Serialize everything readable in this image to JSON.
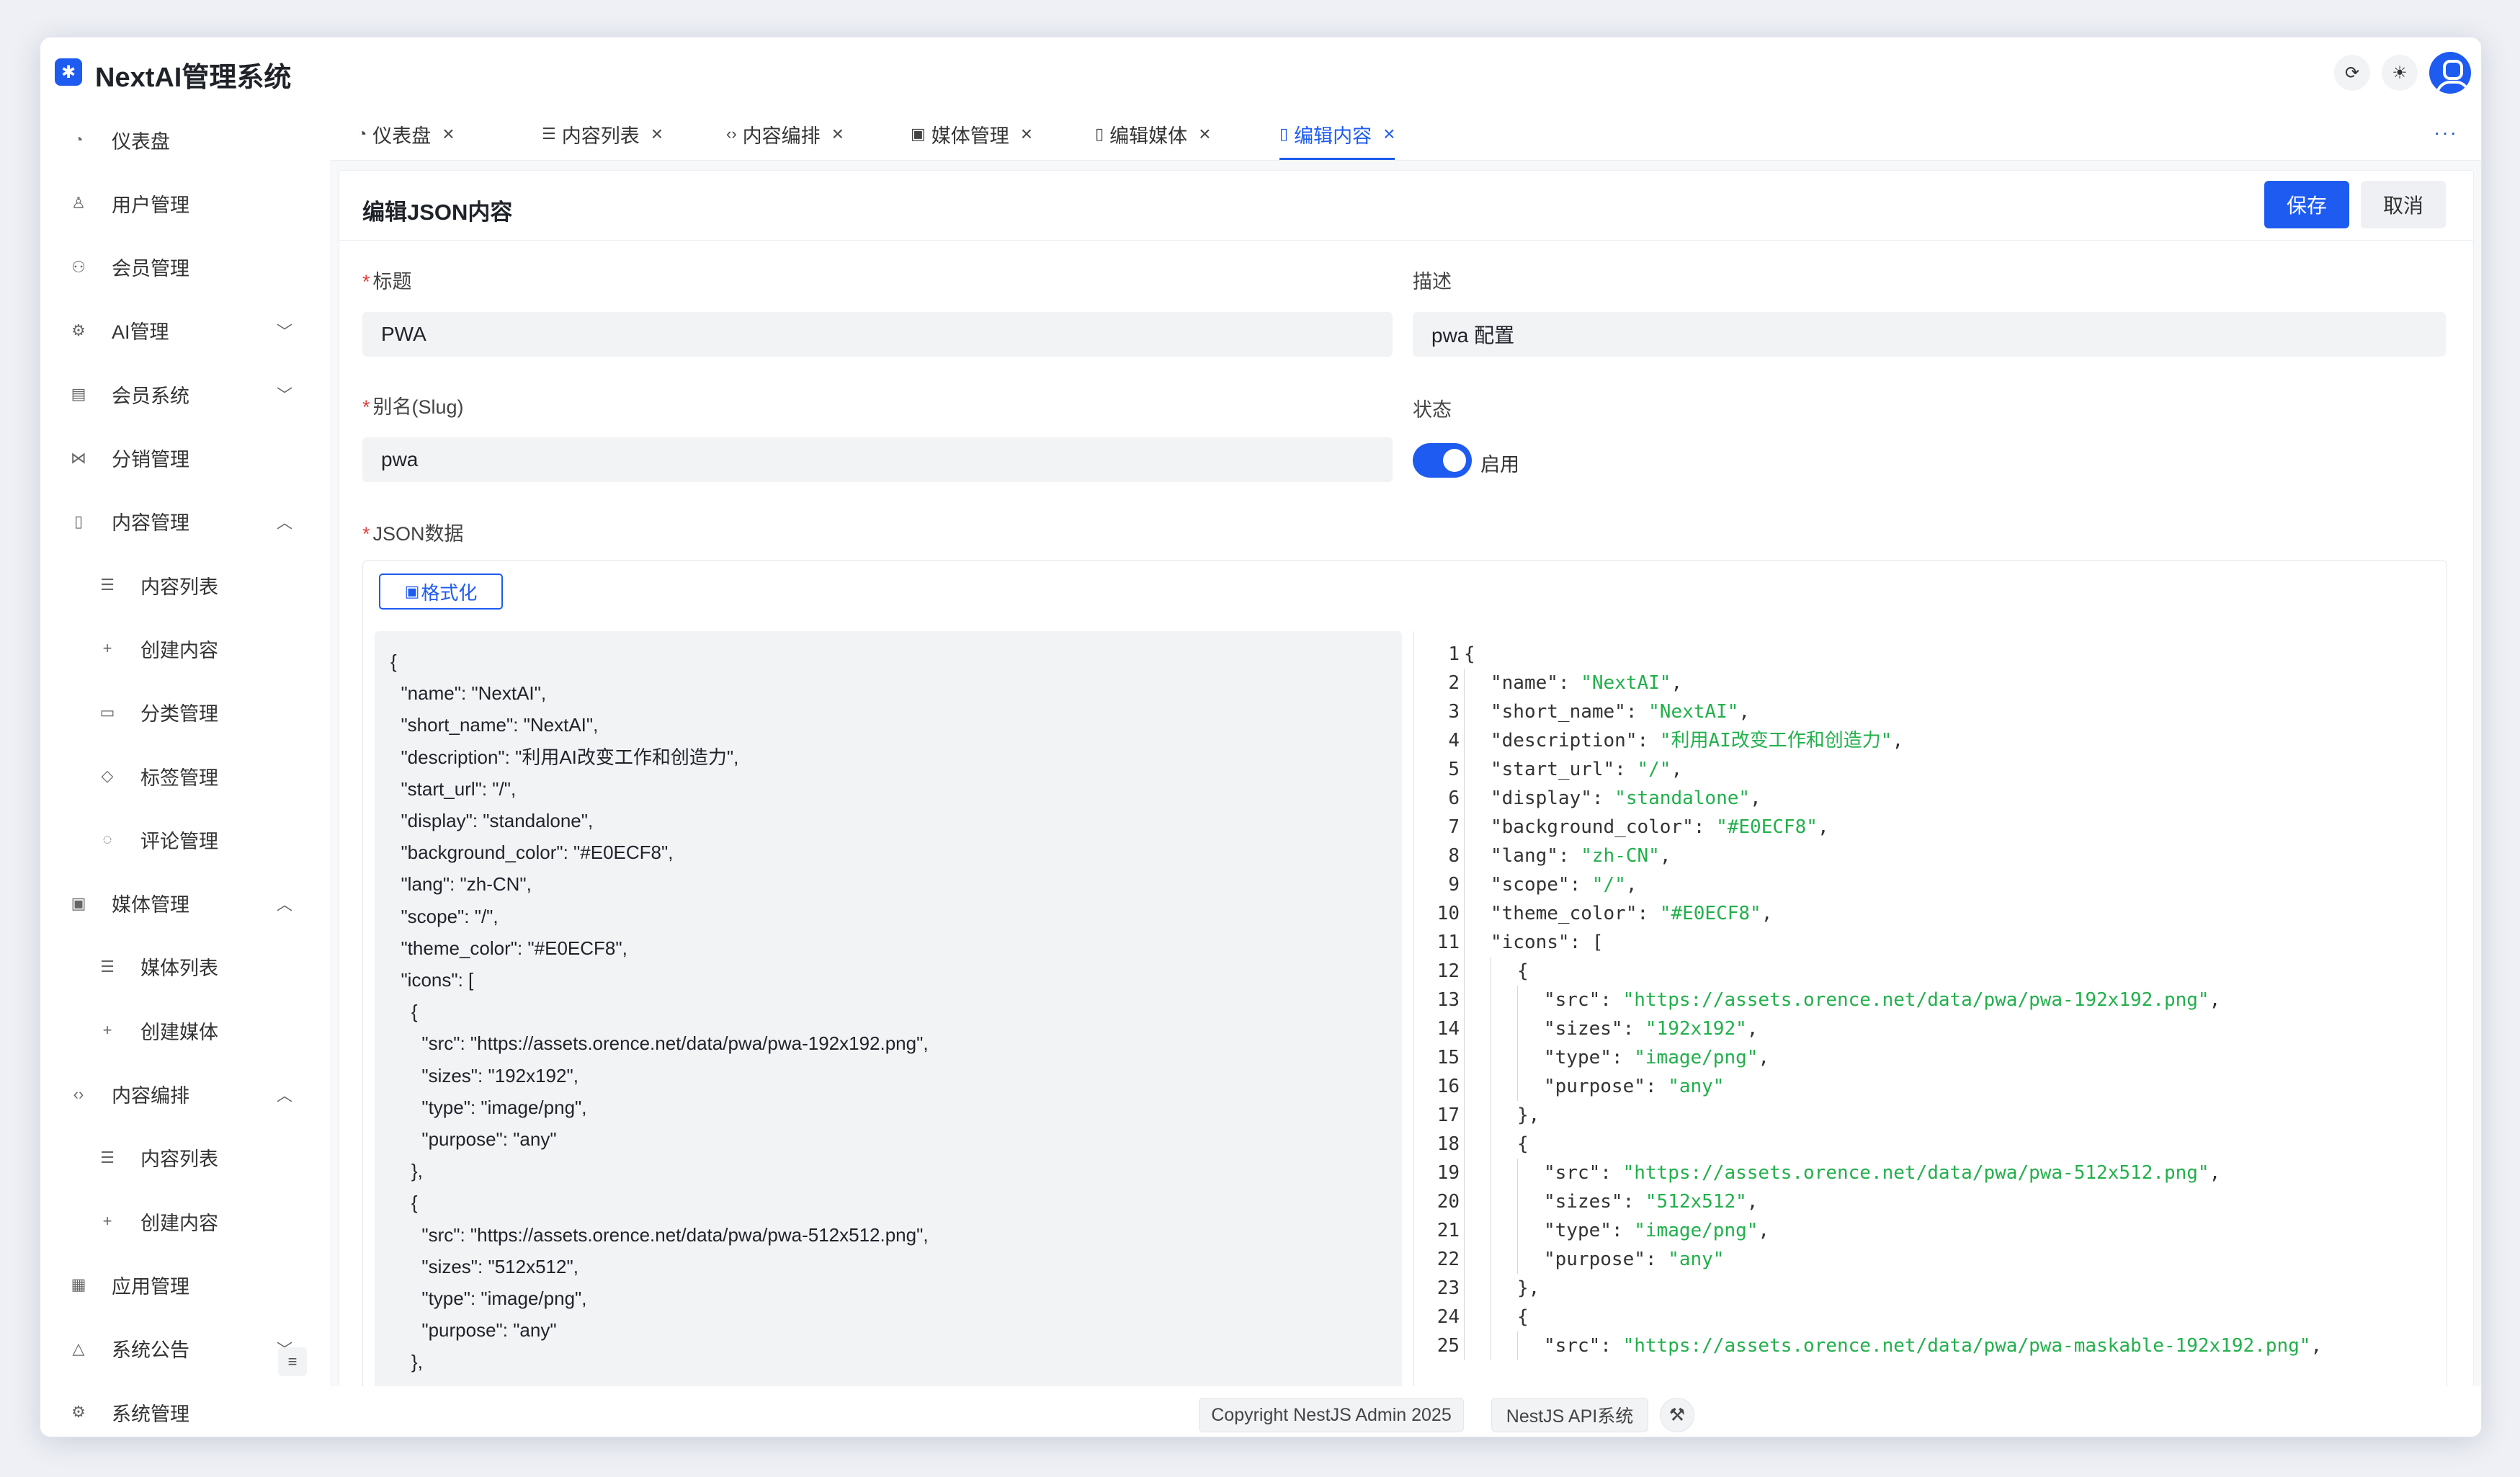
{
  "app": {
    "title": "NextAI管理系统"
  },
  "header": {
    "refresh_icon": "refresh-icon",
    "theme_icon": "sun-icon",
    "avatar_icon": "user-icon"
  },
  "sidebar": {
    "items": [
      {
        "label": "仪表盘",
        "icon": "dashboard-icon"
      },
      {
        "label": "用户管理",
        "icon": "user-icon"
      },
      {
        "label": "会员管理",
        "icon": "members-icon"
      },
      {
        "label": "AI管理",
        "icon": "robot-icon",
        "chevron": "down"
      },
      {
        "label": "会员系统",
        "icon": "gift-icon",
        "chevron": "down"
      },
      {
        "label": "分销管理",
        "icon": "share-icon"
      },
      {
        "label": "内容管理",
        "icon": "document-icon",
        "chevron": "up"
      },
      {
        "label": "内容列表",
        "icon": "list-icon",
        "sub": true
      },
      {
        "label": "创建内容",
        "icon": "plus-icon",
        "sub": true
      },
      {
        "label": "分类管理",
        "icon": "folder-icon",
        "sub": true
      },
      {
        "label": "标签管理",
        "icon": "tag-icon",
        "sub": true
      },
      {
        "label": "评论管理",
        "icon": "comment-icon",
        "sub": true
      },
      {
        "label": "媒体管理",
        "icon": "image-icon",
        "chevron": "up"
      },
      {
        "label": "媒体列表",
        "icon": "list-icon",
        "sub": true
      },
      {
        "label": "创建媒体",
        "icon": "plus-icon",
        "sub": true
      },
      {
        "label": "内容编排",
        "icon": "code-icon",
        "chevron": "up"
      },
      {
        "label": "内容列表",
        "icon": "list-icon",
        "sub": true
      },
      {
        "label": "创建内容",
        "icon": "plus-icon",
        "sub": true
      },
      {
        "label": "应用管理",
        "icon": "grid-icon"
      },
      {
        "label": "系统公告",
        "icon": "bell-icon",
        "chevron": "down"
      },
      {
        "label": "系统管理",
        "icon": "gear-icon"
      }
    ]
  },
  "tabs": [
    {
      "label": "仪表盘",
      "icon": "dashboard-icon"
    },
    {
      "label": "内容列表",
      "icon": "list-icon"
    },
    {
      "label": "内容编排",
      "icon": "code-icon"
    },
    {
      "label": "媒体管理",
      "icon": "image-icon"
    },
    {
      "label": "编辑媒体",
      "icon": "document-icon"
    },
    {
      "label": "编辑内容",
      "icon": "document-icon",
      "active": true
    }
  ],
  "page": {
    "title": "编辑JSON内容",
    "save_label": "保存",
    "cancel_label": "取消"
  },
  "form": {
    "title_label": "标题",
    "title_value": "PWA",
    "desc_label": "描述",
    "desc_value": "pwa 配置",
    "slug_label": "别名(Slug)",
    "slug_value": "pwa",
    "status_label": "状态",
    "status_value": "启用",
    "status_enabled": true,
    "json_label": "JSON数据",
    "format_label": "格式化"
  },
  "json_raw": [
    "{",
    "  \"name\": \"NextAI\",",
    "  \"short_name\": \"NextAI\",",
    "  \"description\": \"利用AI改变工作和创造力\",",
    "  \"start_url\": \"/\",",
    "  \"display\": \"standalone\",",
    "  \"background_color\": \"#E0ECF8\",",
    "  \"lang\": \"zh-CN\",",
    "  \"scope\": \"/\",",
    "  \"theme_color\": \"#E0ECF8\",",
    "  \"icons\": [",
    "    {",
    "      \"src\": \"https://assets.orence.net/data/pwa/pwa-192x192.png\",",
    "      \"sizes\": \"192x192\",",
    "      \"type\": \"image/png\",",
    "      \"purpose\": \"any\"",
    "    },",
    "    {",
    "      \"src\": \"https://assets.orence.net/data/pwa/pwa-512x512.png\",",
    "      \"sizes\": \"512x512\",",
    "      \"type\": \"image/png\",",
    "      \"purpose\": \"any\"",
    "    },"
  ],
  "json_preview": [
    {
      "n": 1,
      "indent": 0,
      "key": "",
      "val": "",
      "suffix": "{"
    },
    {
      "n": 2,
      "indent": 1,
      "key": "name",
      "val": "NextAI",
      "suffix": ","
    },
    {
      "n": 3,
      "indent": 1,
      "key": "short_name",
      "val": "NextAI",
      "suffix": ","
    },
    {
      "n": 4,
      "indent": 1,
      "key": "description",
      "val": "利用AI改变工作和创造力",
      "suffix": ","
    },
    {
      "n": 5,
      "indent": 1,
      "key": "start_url",
      "val": "/",
      "suffix": ","
    },
    {
      "n": 6,
      "indent": 1,
      "key": "display",
      "val": "standalone",
      "suffix": ","
    },
    {
      "n": 7,
      "indent": 1,
      "key": "background_color",
      "val": "#E0ECF8",
      "suffix": ","
    },
    {
      "n": 8,
      "indent": 1,
      "key": "lang",
      "val": "zh-CN",
      "suffix": ","
    },
    {
      "n": 9,
      "indent": 1,
      "key": "scope",
      "val": "/",
      "suffix": ","
    },
    {
      "n": 10,
      "indent": 1,
      "key": "theme_color",
      "val": "#E0ECF8",
      "suffix": ","
    },
    {
      "n": 11,
      "indent": 1,
      "key": "icons",
      "val": "",
      "suffix": "["
    },
    {
      "n": 12,
      "indent": 2,
      "key": "",
      "val": "",
      "suffix": "{"
    },
    {
      "n": 13,
      "indent": 3,
      "key": "src",
      "val": "https://assets.orence.net/data/pwa/pwa-192x192.png",
      "suffix": ","
    },
    {
      "n": 14,
      "indent": 3,
      "key": "sizes",
      "val": "192x192",
      "suffix": ","
    },
    {
      "n": 15,
      "indent": 3,
      "key": "type",
      "val": "image/png",
      "suffix": ","
    },
    {
      "n": 16,
      "indent": 3,
      "key": "purpose",
      "val": "any",
      "suffix": ""
    },
    {
      "n": 17,
      "indent": 2,
      "key": "",
      "val": "",
      "suffix": "},"
    },
    {
      "n": 18,
      "indent": 2,
      "key": "",
      "val": "",
      "suffix": "{"
    },
    {
      "n": 19,
      "indent": 3,
      "key": "src",
      "val": "https://assets.orence.net/data/pwa/pwa-512x512.png",
      "suffix": ","
    },
    {
      "n": 20,
      "indent": 3,
      "key": "sizes",
      "val": "512x512",
      "suffix": ","
    },
    {
      "n": 21,
      "indent": 3,
      "key": "type",
      "val": "image/png",
      "suffix": ","
    },
    {
      "n": 22,
      "indent": 3,
      "key": "purpose",
      "val": "any",
      "suffix": ""
    },
    {
      "n": 23,
      "indent": 2,
      "key": "",
      "val": "",
      "suffix": "},"
    },
    {
      "n": 24,
      "indent": 2,
      "key": "",
      "val": "",
      "suffix": "{"
    },
    {
      "n": 25,
      "indent": 3,
      "key": "src",
      "val": "https://assets.orence.net/data/pwa/pwa-maskable-192x192.png",
      "suffix": ","
    }
  ],
  "footer": {
    "copyright": "Copyright NestJS Admin 2025",
    "api_label": "NestJS API系统",
    "tool_icon": "wrench-icon"
  },
  "colors": {
    "primary": "#1e5bf0",
    "json_string": "#22b04b"
  }
}
